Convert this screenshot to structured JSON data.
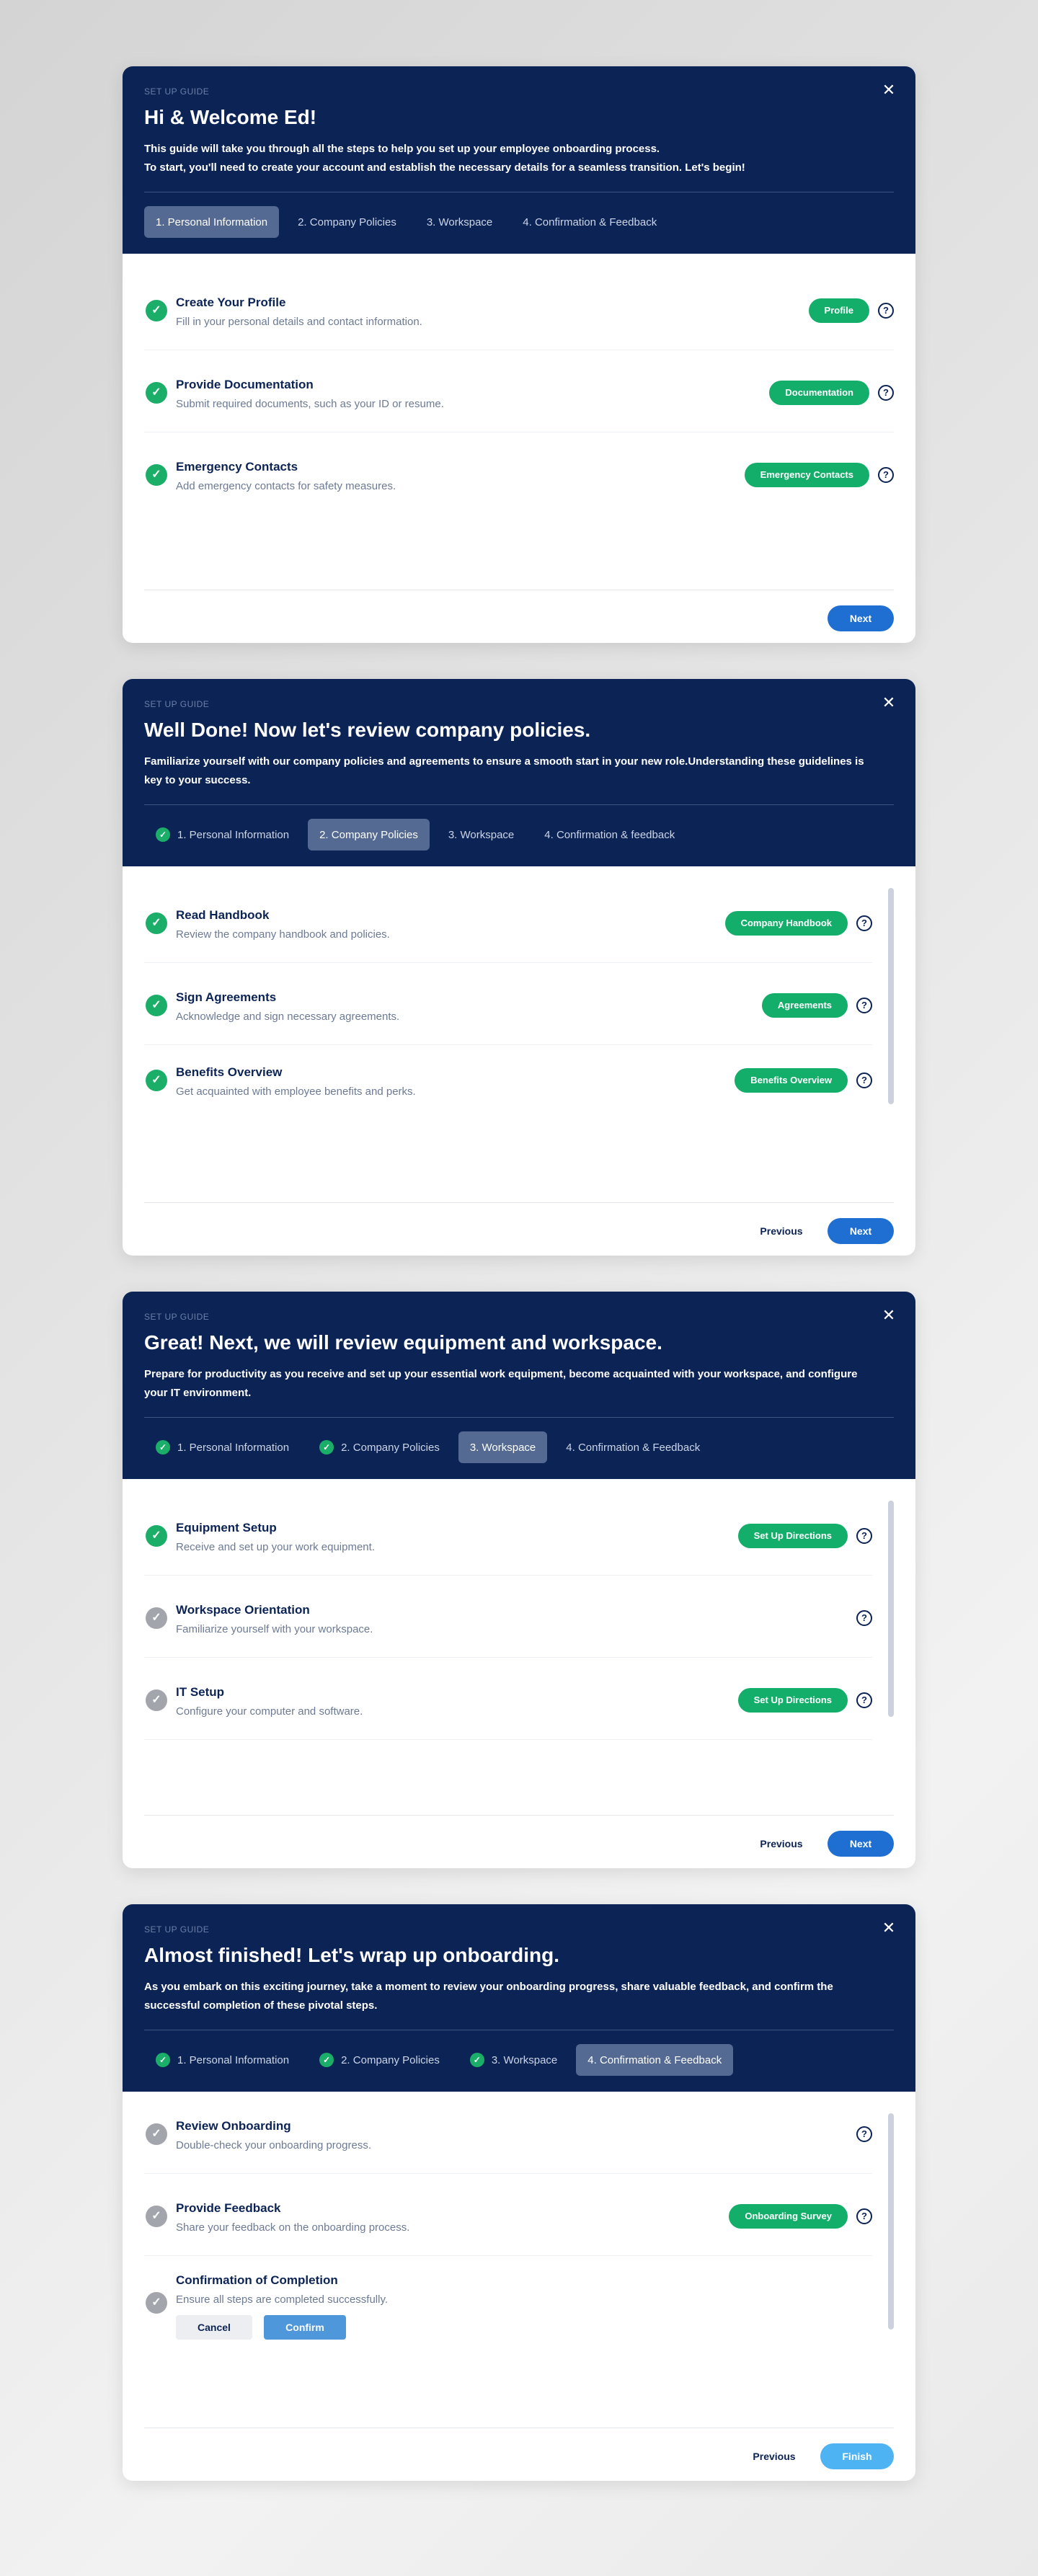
{
  "guide_label": "SET UP GUIDE",
  "tabs": {
    "personal": "1. Personal Information",
    "policies": "2. Company Policies",
    "workspace": "3. Workspace",
    "confirmation": "4. Confirmation & Feedback",
    "confirmation_lower": "4. Confirmation & feedback"
  },
  "buttons": {
    "next": "Next",
    "previous": "Previous",
    "finish": "Finish",
    "cancel": "Cancel",
    "confirm": "Confirm"
  },
  "icons": {
    "close": "close-icon",
    "check": "check-icon",
    "help": "help-circle-icon"
  },
  "colors": {
    "header_bg": "#0c2356",
    "success": "#12ae6a",
    "primary": "#1e6fd1",
    "pending": "#a2a5ab"
  },
  "step1": {
    "title": "Hi & Welcome Ed!",
    "desc_line1": "This guide will take you through all the steps to help you set up your employee onboarding process.",
    "desc_line2": "To start, you'll need to create your account and establish the necessary details for a seamless transition. Let's begin!",
    "tasks": [
      {
        "title": "Create Your Profile",
        "subtitle": "Fill in your personal details and contact information.",
        "button": "Profile"
      },
      {
        "title": "Provide Documentation",
        "subtitle": "Submit required documents, such as your ID or resume.",
        "button": "Documentation"
      },
      {
        "title": "Emergency Contacts",
        "subtitle": "Add emergency contacts for safety measures.",
        "button": "Emergency Contacts"
      }
    ]
  },
  "step2": {
    "title": "Well Done! Now let's review company policies.",
    "desc": "Familiarize yourself with our company policies and agreements to ensure a smooth start in your new role.Understanding these guidelines is key to your success.",
    "tasks": [
      {
        "title": "Read Handbook",
        "subtitle": "Review the company handbook and policies.",
        "button": "Company Handbook"
      },
      {
        "title": "Sign Agreements",
        "subtitle": "Acknowledge and sign necessary agreements.",
        "button": "Agreements"
      },
      {
        "title": "Benefits Overview",
        "subtitle": "Get acquainted with employee benefits and perks.",
        "button": "Benefits Overview"
      }
    ]
  },
  "step3": {
    "title": "Great! Next, we will review equipment and workspace.",
    "desc": "Prepare for productivity as you receive and set up your essential work equipment, become acquainted with your workspace, and configure your IT environment.",
    "tasks": [
      {
        "title": "Equipment Setup",
        "subtitle": "Receive and set up your work equipment.",
        "button": "Set Up Directions"
      },
      {
        "title": "Workspace Orientation",
        "subtitle": "Familiarize yourself with your workspace."
      },
      {
        "title": "IT Setup",
        "subtitle": "Configure your computer and software.",
        "button": "Set Up Directions"
      }
    ]
  },
  "step4": {
    "title": "Almost finished! Let's wrap up onboarding.",
    "desc": "As you embark on this exciting journey, take a moment to review your onboarding progress, share valuable feedback, and confirm the successful completion of these pivotal steps.",
    "tasks": [
      {
        "title": "Review Onboarding",
        "subtitle": "Double-check your onboarding progress."
      },
      {
        "title": "Provide Feedback",
        "subtitle": "Share your feedback on the onboarding process.",
        "button": "Onboarding Survey"
      },
      {
        "title": "Confirmation of Completion",
        "subtitle": "Ensure all steps are completed successfully."
      }
    ]
  }
}
